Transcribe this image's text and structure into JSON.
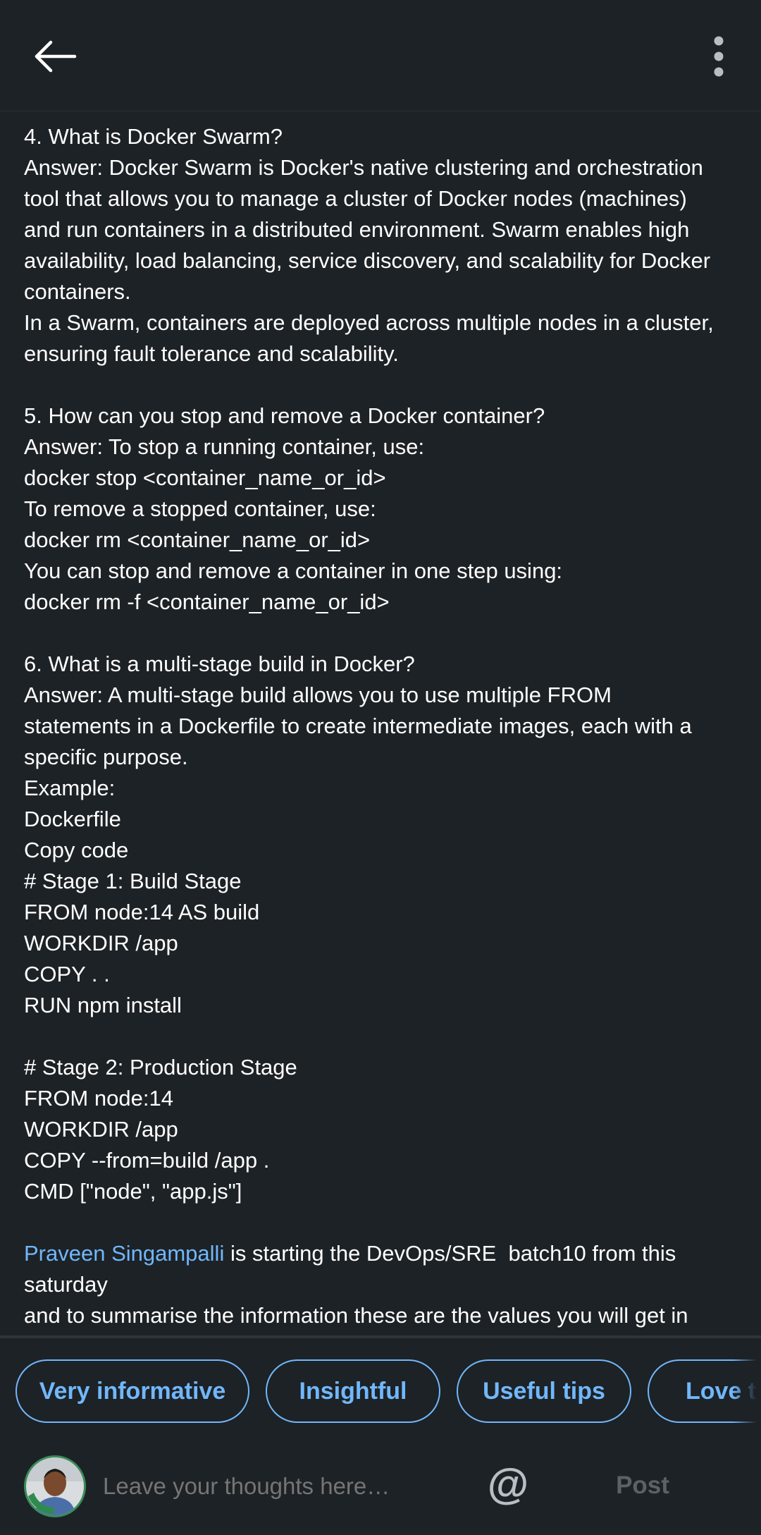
{
  "header": {
    "back_icon": "arrow-left-icon",
    "more_icon": "more-vertical-icon"
  },
  "article": {
    "lines": [
      "4. What is Docker Swarm?",
      "Answer: Docker Swarm is Docker's native clustering and orchestration",
      "tool that allows you to manage a cluster of Docker nodes (machines)",
      "and run containers in a distributed environment. Swarm enables high",
      "availability, load balancing, service discovery, and scalability for Docker",
      "containers.",
      "In a Swarm, containers are deployed across multiple nodes in a cluster,",
      "ensuring fault tolerance and scalability.",
      "",
      "5. How can you stop and remove a Docker container?",
      "Answer: To stop a running container, use:",
      "docker stop <container_name_or_id>",
      "To remove a stopped container, use:",
      "docker rm <container_name_or_id>",
      "You can stop and remove a container in one step using:",
      "docker rm -f <container_name_or_id>",
      "",
      "6. What is a multi-stage build in Docker?",
      "Answer: A multi-stage build allows you to use multiple FROM",
      "statements in a Dockerfile to create intermediate images, each with a",
      "specific purpose.",
      "Example:",
      "Dockerfile",
      "Copy code",
      "# Stage 1: Build Stage",
      "FROM node:14 AS build",
      "WORKDIR /app",
      "COPY . .",
      "RUN npm install",
      "",
      "# Stage 2: Production Stage",
      "FROM node:14",
      "WORKDIR /app",
      "COPY --from=build /app .",
      "CMD [\"node\", \"app.js\"]",
      ""
    ],
    "mention_name": "Praveen Singampalli",
    "mention_rest": " is starting the DevOps/SRE  batch10 from this",
    "tail_lines": [
      "saturday",
      "and to summarise the information these are the values you will get in"
    ]
  },
  "reactions": [
    {
      "label": "Very informative"
    },
    {
      "label": "Insightful"
    },
    {
      "label": "Useful tips"
    },
    {
      "label": "Love this"
    }
  ],
  "composer": {
    "placeholder": "Leave your thoughts here…",
    "mention_symbol": "@",
    "post_label": "Post",
    "avatar_badge": "OPENTOWORK"
  },
  "colors": {
    "background": "#1d2226",
    "text": "#ffffff",
    "accent": "#71b7fb",
    "muted": "#9aa2a9",
    "disabled": "#5b6167"
  }
}
